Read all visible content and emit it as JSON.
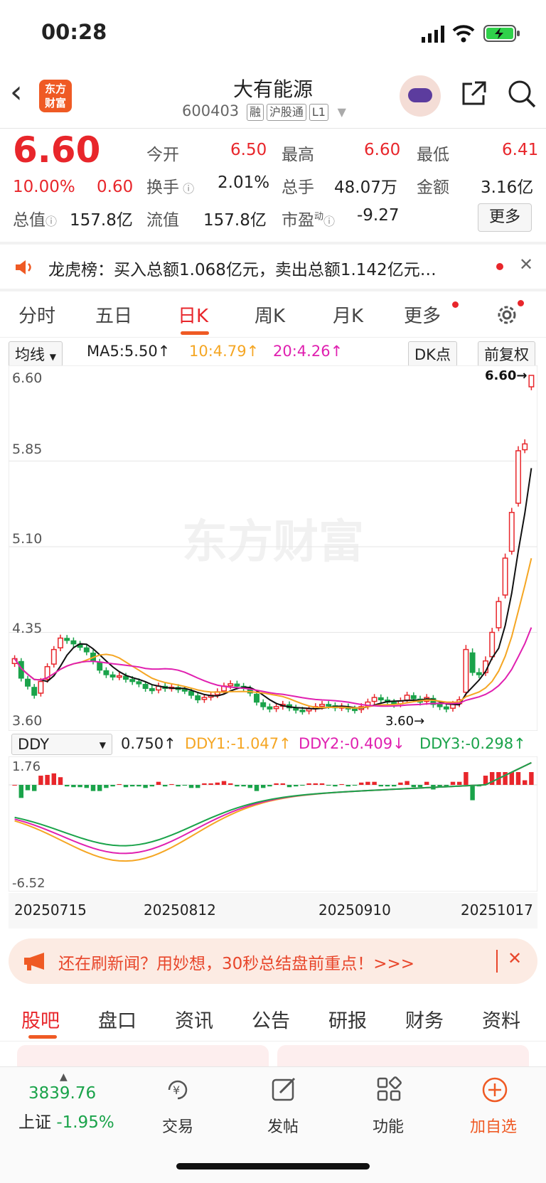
{
  "status_bar": {
    "time": "00:28"
  },
  "header": {
    "stock_name": "大有能源",
    "code": "600403",
    "tags": [
      "融",
      "沪股通",
      "L1"
    ],
    "logo_text_top": "东方",
    "logo_text_bottom": "财富"
  },
  "quote": {
    "price": "6.60",
    "change_pct": "10.00%",
    "change": "0.60",
    "open_label": "今开",
    "open": "6.50",
    "high_label": "最高",
    "high": "6.60",
    "low_label": "最低",
    "low": "6.41",
    "turnover_label": "换手",
    "turnover": "2.01%",
    "volume_label": "总手",
    "volume": "48.07万",
    "amount_label": "金额",
    "amount": "3.16亿",
    "mcap_label": "总值",
    "mcap": "157.8亿",
    "float_label": "流值",
    "float_cap": "157.8亿",
    "pe_label": "市盈",
    "pe_sup": "动",
    "pe": "-9.27",
    "more_label": "更多"
  },
  "notice": {
    "text": "龙虎榜：买入总额1.068亿元，卖出总额1.142亿元…"
  },
  "period_tabs": [
    "分时",
    "五日",
    "日K",
    "周K",
    "月K",
    "更多"
  ],
  "ma": {
    "selector": "均线",
    "ma5": "MA5:5.50",
    "ma10": "10:4.79",
    "ma20": "20:4.26",
    "dk": "DK点",
    "adjust": "前复权"
  },
  "chart": {
    "y_labels": [
      "6.60",
      "5.85",
      "5.10",
      "4.35",
      "3.60"
    ],
    "max_marker": "6.60→",
    "min_marker": "3.60→",
    "watermark": "东方财富"
  },
  "ddy": {
    "selector": "DDY",
    "ddy": "0.750",
    "ddy1": "DDY1:-1.047",
    "ddy2": "DDY2:-0.409",
    "ddy3": "DDY3:-0.298",
    "y_top": "1.76",
    "y_bottom": "-6.52"
  },
  "dates": [
    "20250715",
    "20250812",
    "20250910",
    "20251017"
  ],
  "banner": {
    "text": "还在刷新闻？用妙想，30秒总结盘前重点！>>>"
  },
  "bottom_tabs": [
    "股吧",
    "盘口",
    "资讯",
    "公告",
    "研报",
    "财务",
    "资料"
  ],
  "nav": {
    "index_value": "3839.76",
    "index_name": "上证",
    "index_pct": "-1.95%",
    "items": [
      "交易",
      "发帖",
      "功能",
      "加自选"
    ]
  },
  "colors": {
    "up": "#e8262b",
    "down": "#1aa34a",
    "ma5": "#111111",
    "ma10": "#f5a623",
    "ma20": "#e020b0",
    "accent": "#ef5a24"
  },
  "chart_data": {
    "type": "candlestick",
    "ylim": [
      3.6,
      6.6
    ],
    "ma_last": {
      "MA5": 5.5,
      "MA10": 4.79,
      "MA20": 4.26
    },
    "closes": [
      4.12,
      3.95,
      3.88,
      3.8,
      3.92,
      4.05,
      4.2,
      4.3,
      4.28,
      4.25,
      4.22,
      4.18,
      4.1,
      4.02,
      3.98,
      3.96,
      3.97,
      3.94,
      3.92,
      3.9,
      3.86,
      3.84,
      3.88,
      3.86,
      3.87,
      3.85,
      3.84,
      3.8,
      3.76,
      3.78,
      3.8,
      3.83,
      3.88,
      3.9,
      3.88,
      3.86,
      3.82,
      3.74,
      3.7,
      3.68,
      3.7,
      3.72,
      3.69,
      3.67,
      3.66,
      3.68,
      3.7,
      3.72,
      3.71,
      3.69,
      3.7,
      3.68,
      3.67,
      3.7,
      3.74,
      3.78,
      3.76,
      3.74,
      3.72,
      3.75,
      3.8,
      3.77,
      3.74,
      3.78,
      3.72,
      3.7,
      3.68,
      3.72,
      3.76,
      4.2,
      4.0,
      3.98,
      4.1,
      4.35,
      4.62,
      5.0,
      5.4,
      5.94,
      6.0,
      6.6
    ]
  }
}
